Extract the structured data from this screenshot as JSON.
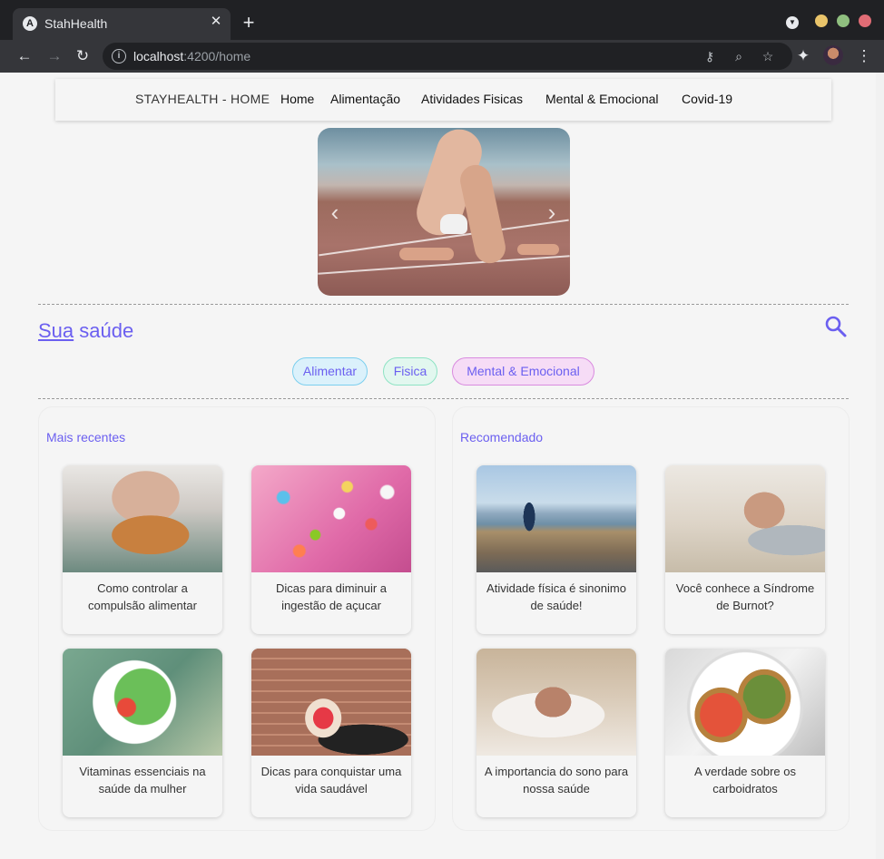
{
  "browser": {
    "tab_title": "StahHealth",
    "tab_favicon_letter": "A",
    "url_host": "localhost",
    "url_path": ":4200/home",
    "colors": {
      "chrome_dark": "#202124",
      "chrome_tab": "#35363a"
    }
  },
  "navbar": {
    "brand": "STAYHEALTH - HOME",
    "links": [
      "Home",
      "Alimentação",
      "Atividades Fisicas",
      "Mental & Emocional",
      "Covid-19"
    ]
  },
  "carousel": {
    "prev_icon": "chevron-left-icon",
    "next_icon": "chevron-right-icon"
  },
  "section": {
    "title_underlined": "Sua",
    "title_rest": " saúde",
    "search_icon": "search-icon"
  },
  "filters": [
    "Alimentar",
    "Fisica",
    "Mental & Emocional"
  ],
  "panels": [
    {
      "title": "Mais recentes",
      "cards": [
        {
          "text": "Como controlar a compulsão alimentar"
        },
        {
          "text": "Dicas para diminuir a ingestão de açucar"
        },
        {
          "text": "Vitaminas essenciais na saúde da mulher"
        },
        {
          "text": "Dicas para conquistar uma vida saudável"
        }
      ]
    },
    {
      "title": "Recomendado",
      "cards": [
        {
          "text": "Atividade física é sinonimo de saúde!"
        },
        {
          "text": "Você conhece a Síndrome de Burnot?"
        },
        {
          "text": "A importancia do sono para nossa saúde"
        },
        {
          "text": "A verdade sobre os carboidratos"
        }
      ]
    }
  ],
  "colors": {
    "accent": "#6b5ff0",
    "chip_alimentar": "#dbf1fb",
    "chip_fisica": "#e2f7ef",
    "chip_mental": "#f6dcf6",
    "page_bg": "#f5f5f5"
  }
}
